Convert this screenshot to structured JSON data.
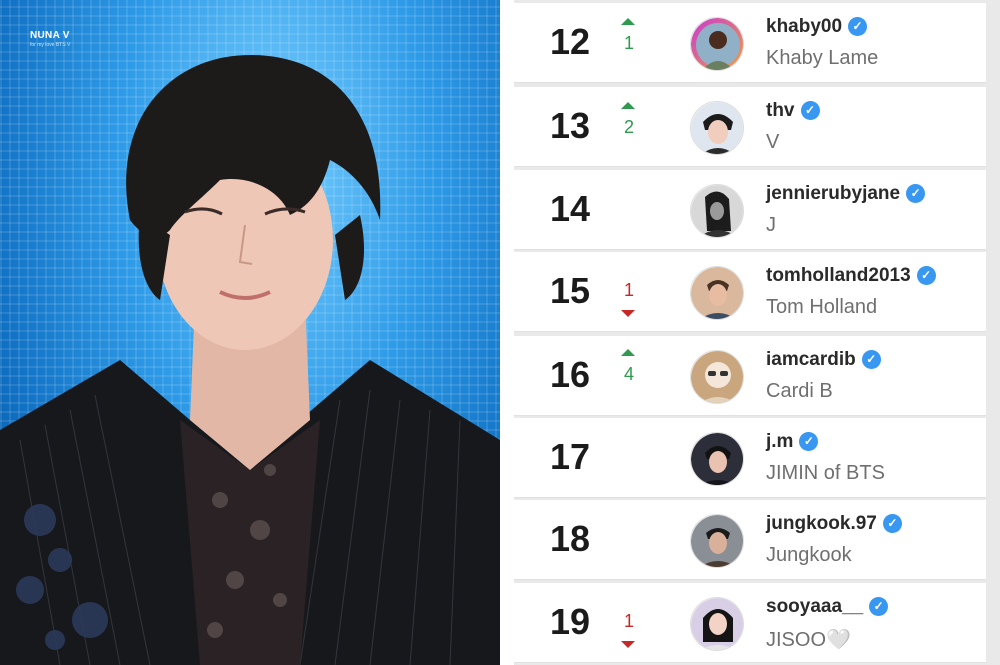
{
  "photo": {
    "watermark": "NUNA V",
    "watermark_sub": "for my love BTS V"
  },
  "ranking": {
    "rows": [
      {
        "rank": "12",
        "change": "1",
        "direction": "up",
        "handle": "khaby00",
        "name": "Khaby Lame",
        "avatar": "khaby-avatar"
      },
      {
        "rank": "13",
        "change": "2",
        "direction": "up",
        "handle": "thv",
        "name": "V",
        "avatar": "thv-avatar"
      },
      {
        "rank": "14",
        "change": "",
        "direction": "none",
        "handle": "jennierubyjane",
        "name": "J",
        "avatar": "jennie-avatar"
      },
      {
        "rank": "15",
        "change": "1",
        "direction": "down",
        "handle": "tomholland2013",
        "name": "Tom Holland",
        "avatar": "tom-avatar"
      },
      {
        "rank": "16",
        "change": "4",
        "direction": "up",
        "handle": "iamcardib",
        "name": "Cardi B",
        "avatar": "cardib-avatar"
      },
      {
        "rank": "17",
        "change": "",
        "direction": "none",
        "handle": "j.m",
        "name": "JIMIN of BTS",
        "avatar": "jimin-avatar"
      },
      {
        "rank": "18",
        "change": "",
        "direction": "none",
        "handle": "jungkook.97",
        "name": "Jungkook",
        "avatar": "jungkook-avatar"
      },
      {
        "rank": "19",
        "change": "1",
        "direction": "down",
        "handle": "sooyaaa__",
        "name": "JISOO🤍",
        "avatar": "jisoo-avatar"
      }
    ]
  },
  "colors": {
    "up": "#2f9a4e",
    "down": "#c62828",
    "verified": "#3897f0",
    "handle": "#2a2a2a",
    "name": "#6f6f6f"
  }
}
